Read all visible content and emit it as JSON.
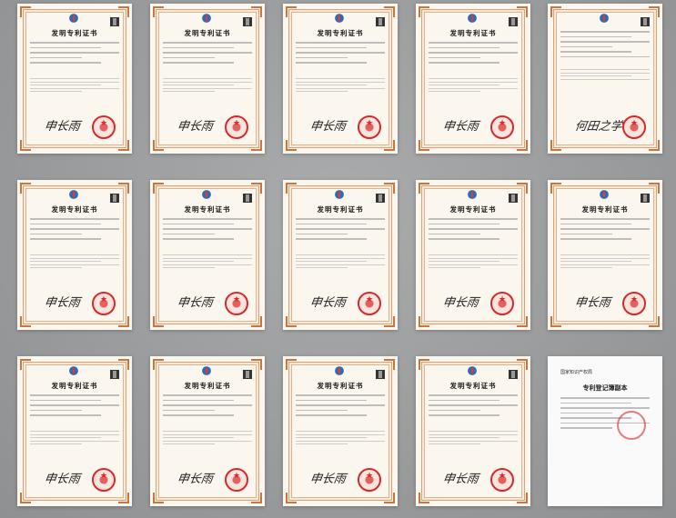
{
  "certificates": [
    {
      "title": "发明专利证书",
      "signature": "申长雨"
    },
    {
      "title": "发明专利证书",
      "signature": "申长雨"
    },
    {
      "title": "发明专利证书",
      "signature": "申长雨"
    },
    {
      "title": "发明专利证书",
      "signature": "申长雨"
    },
    {
      "title": "",
      "signature": "何田之学"
    },
    {
      "title": "发明专利证书",
      "signature": "申长雨"
    },
    {
      "title": "发明专利证书",
      "signature": "申长雨"
    },
    {
      "title": "发明专利证书",
      "signature": "申长雨"
    },
    {
      "title": "发明专利证书",
      "signature": "申长雨"
    },
    {
      "title": "发明专利证书",
      "signature": "申长雨"
    },
    {
      "title": "发明专利证书",
      "signature": "申长雨"
    },
    {
      "title": "发明专利证书",
      "signature": "申长雨"
    },
    {
      "title": "发明专利证书",
      "signature": "申长雨"
    },
    {
      "title": "发明专利证书",
      "signature": "申长雨"
    }
  ],
  "register": {
    "header": "国家知识产权局",
    "title": "专利登记簿副本"
  },
  "colors": {
    "frame": "#d4a57a",
    "seal": "#d8282a",
    "background": "#9a9c9e"
  }
}
